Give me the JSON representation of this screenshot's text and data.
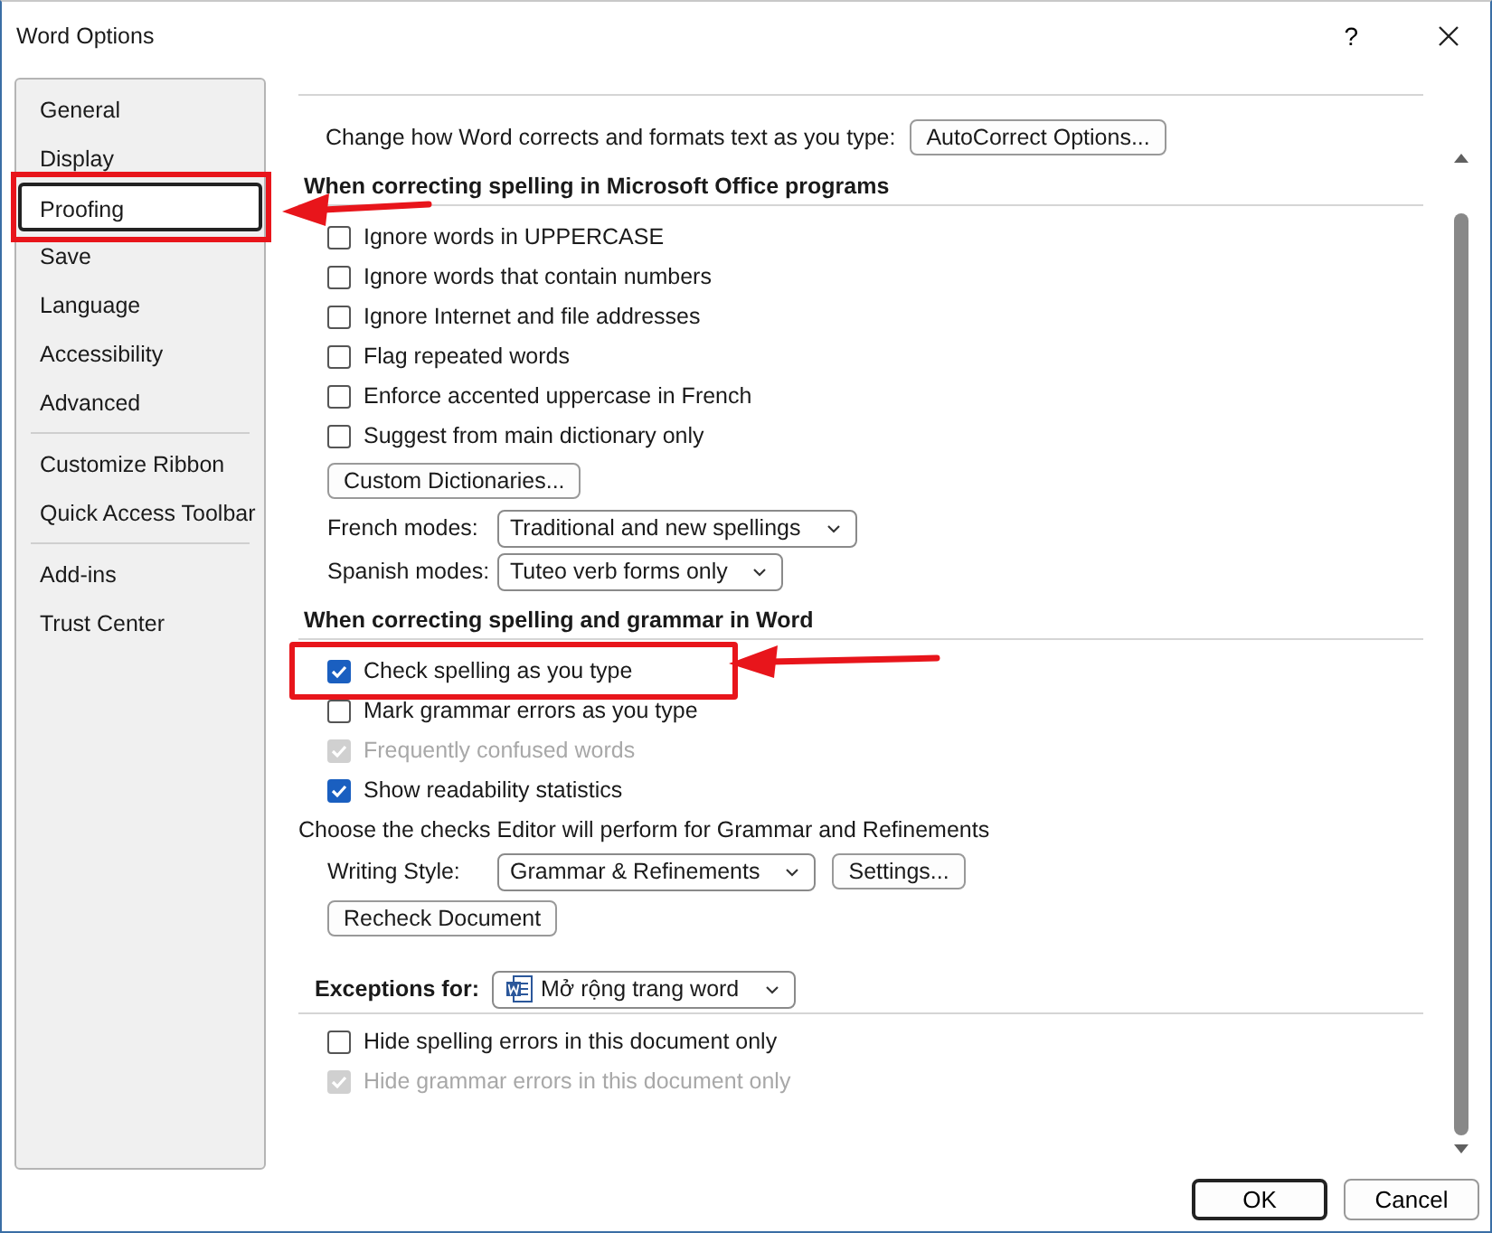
{
  "window": {
    "title": "Word Options",
    "help": "?"
  },
  "sidebar": {
    "groups": [
      {
        "items": [
          {
            "label": "General",
            "selected": false,
            "highlighted": false
          },
          {
            "label": "Display",
            "selected": false,
            "highlighted": false
          },
          {
            "label": "Proofing",
            "selected": true,
            "highlighted": true
          },
          {
            "label": "Save",
            "selected": false,
            "highlighted": false
          },
          {
            "label": "Language",
            "selected": false,
            "highlighted": false
          },
          {
            "label": "Accessibility",
            "selected": false,
            "highlighted": false
          },
          {
            "label": "Advanced",
            "selected": false,
            "highlighted": false
          }
        ]
      },
      {
        "items": [
          {
            "label": "Customize Ribbon",
            "selected": false,
            "highlighted": false
          },
          {
            "label": "Quick Access Toolbar",
            "selected": false,
            "highlighted": false
          }
        ]
      },
      {
        "items": [
          {
            "label": "Add-ins",
            "selected": false,
            "highlighted": false
          },
          {
            "label": "Trust Center",
            "selected": false,
            "highlighted": false
          }
        ]
      }
    ]
  },
  "content": {
    "rows": [
      {
        "kind": "text_button",
        "text": "Change how Word corrects and formats text as you type:",
        "button": "AutoCorrect Options..."
      },
      {
        "kind": "heading",
        "text": "When correcting spelling in Microsoft Office programs"
      },
      {
        "kind": "checkbox",
        "label": "Ignore words in UPPERCASE",
        "checked": false,
        "disabled": false,
        "highlighted": false
      },
      {
        "kind": "checkbox",
        "label": "Ignore words that contain numbers",
        "checked": false,
        "disabled": false,
        "highlighted": false
      },
      {
        "kind": "checkbox",
        "label": "Ignore Internet and file addresses",
        "checked": false,
        "disabled": false,
        "highlighted": false
      },
      {
        "kind": "checkbox",
        "label": "Flag repeated words",
        "checked": false,
        "disabled": false,
        "highlighted": false
      },
      {
        "kind": "checkbox",
        "label": "Enforce accented uppercase in French",
        "checked": false,
        "disabled": false,
        "highlighted": false
      },
      {
        "kind": "checkbox",
        "label": "Suggest from main dictionary only",
        "checked": false,
        "disabled": false,
        "highlighted": false
      },
      {
        "kind": "button",
        "label": "Custom Dictionaries..."
      },
      {
        "kind": "dropdown",
        "label": "French modes:",
        "value": "Traditional and new spellings"
      },
      {
        "kind": "dropdown",
        "label": "Spanish modes:",
        "value": "Tuteo verb forms only"
      },
      {
        "kind": "heading",
        "text": "When correcting spelling and grammar in Word"
      },
      {
        "kind": "checkbox",
        "label": "Check spelling as you type",
        "checked": true,
        "disabled": false,
        "highlighted": true
      },
      {
        "kind": "checkbox",
        "label": "Mark grammar errors as you type",
        "checked": false,
        "disabled": false,
        "highlighted": false
      },
      {
        "kind": "checkbox",
        "label": "Frequently confused words",
        "checked": true,
        "disabled": true,
        "highlighted": false
      },
      {
        "kind": "checkbox",
        "label": "Show readability statistics",
        "checked": true,
        "disabled": false,
        "highlighted": false
      },
      {
        "kind": "text",
        "text": "Choose the checks Editor will perform for Grammar and Refinements"
      },
      {
        "kind": "dropdown_button",
        "label": "Writing Style:",
        "value": "Grammar & Refinements",
        "button": "Settings..."
      },
      {
        "kind": "button",
        "label": "Recheck Document"
      },
      {
        "kind": "exceptions",
        "label": "Exceptions for:",
        "value": "Mở rộng trang word"
      },
      {
        "kind": "checkbox",
        "label": "Hide spelling errors in this document only",
        "checked": false,
        "disabled": false,
        "highlighted": false
      },
      {
        "kind": "checkbox",
        "label": "Hide grammar errors in this document only",
        "checked": true,
        "disabled": true,
        "highlighted": false
      }
    ]
  },
  "buttons": [
    {
      "label": "OK",
      "default": true
    },
    {
      "label": "Cancel",
      "default": false
    }
  ]
}
